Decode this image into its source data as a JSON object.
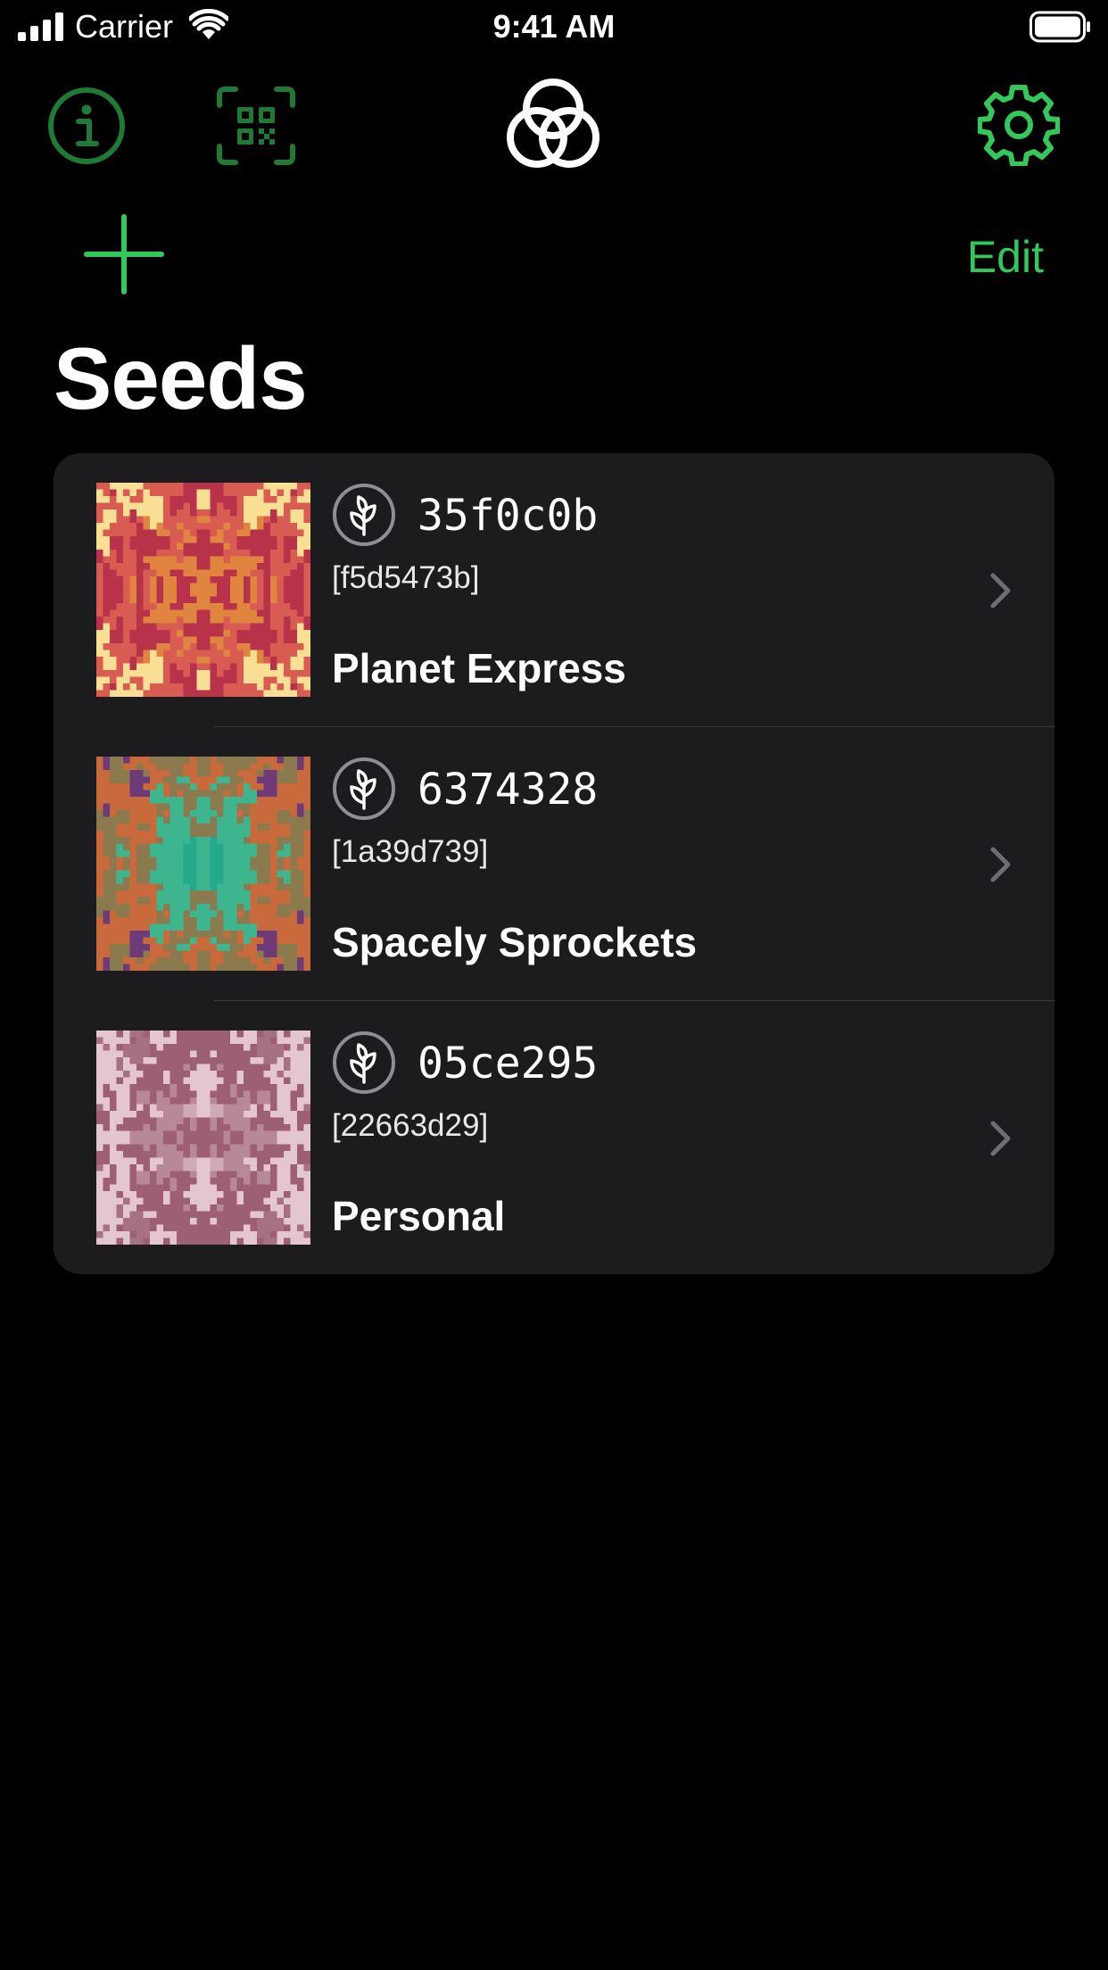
{
  "status_bar": {
    "carrier": "Carrier",
    "time": "9:41 AM"
  },
  "nav": {
    "info_icon": "info-icon",
    "scan_icon": "qr-scan-icon",
    "logo_icon": "blockchain-commons-logo-icon",
    "settings_icon": "gear-icon",
    "add_icon": "plus-icon",
    "edit_label": "Edit",
    "accent_color": "#32c85a"
  },
  "page": {
    "title": "Seeds"
  },
  "seeds": [
    {
      "id": "35f0c0b",
      "fingerprint": "[f5d5473b]",
      "name": "Planet Express",
      "icon": "seed-leaf-icon",
      "palette": [
        "#f5c878",
        "#e0853f",
        "#b8324a",
        "#d85c52",
        "#f9df93",
        "#f2a757"
      ]
    },
    {
      "id": "6374328",
      "fingerprint": "[1a39d739]",
      "name": "Spacely Sprockets",
      "icon": "seed-leaf-icon",
      "palette": [
        "#25a98c",
        "#3db58f",
        "#8a7a4e",
        "#c86a3c",
        "#6e3a78",
        "#5aa76e"
      ]
    },
    {
      "id": "05ce295",
      "fingerprint": "[22663d29]",
      "name": "Personal",
      "icon": "seed-leaf-icon",
      "palette": [
        "#cfabb5",
        "#b78896",
        "#9c5f73",
        "#e3c6cf",
        "#a67283",
        "#d9b6c1"
      ]
    }
  ]
}
